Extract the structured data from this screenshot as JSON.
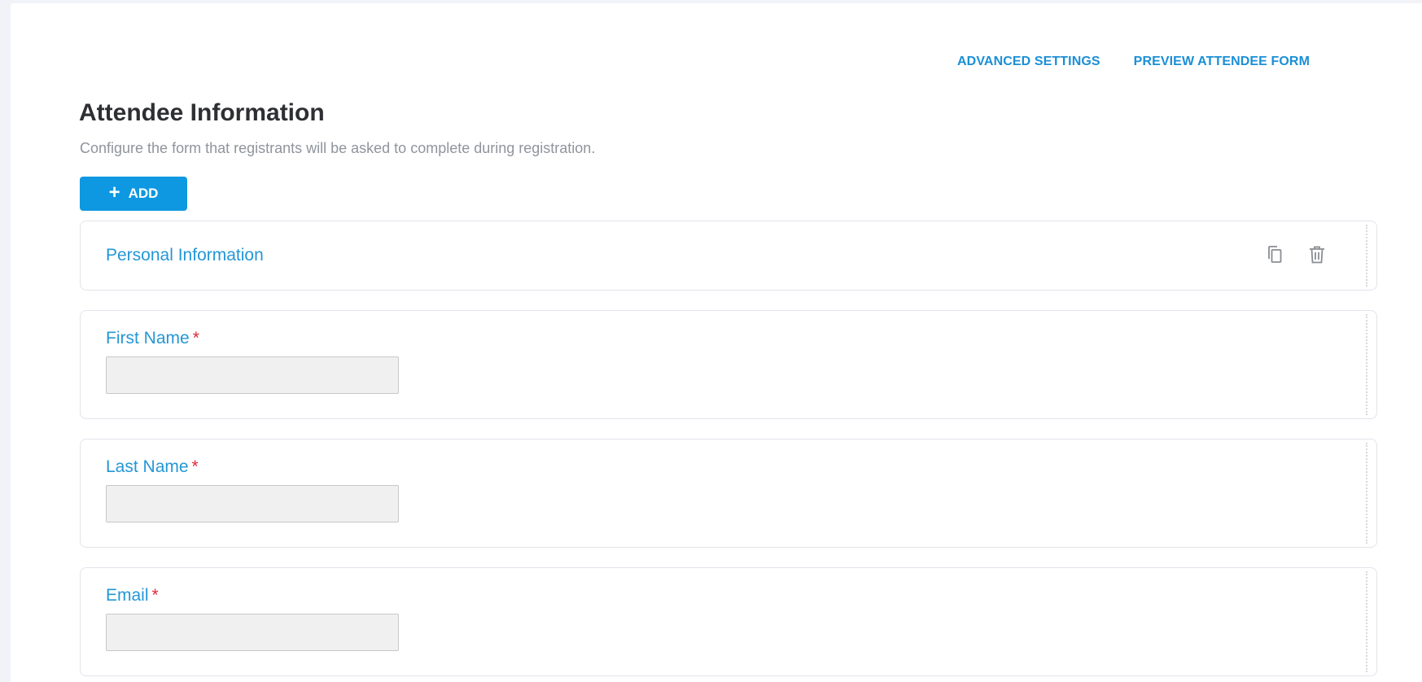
{
  "header": {
    "links": {
      "advanced_settings": "ADVANCED SETTINGS",
      "preview_form": "PREVIEW ATTENDEE FORM"
    },
    "title": "Attendee Information",
    "subtitle": "Configure the form that registrants will be asked to complete during registration."
  },
  "toolbar": {
    "add_label": "ADD",
    "add_icon": "plus-icon"
  },
  "section": {
    "title": "Personal Information",
    "actions": [
      "copy-icon",
      "trash-icon"
    ]
  },
  "fields": [
    {
      "label": "First Name",
      "required_mark": "*",
      "value": ""
    },
    {
      "label": "Last Name",
      "required_mark": "*",
      "value": ""
    },
    {
      "label": "Email",
      "required_mark": "*",
      "value": ""
    }
  ],
  "colors": {
    "accent": "#0e98e1",
    "link": "#1b8fd6",
    "label": "#2497d6",
    "required": "#e3263a",
    "page_bg": "#f1f3f8"
  }
}
